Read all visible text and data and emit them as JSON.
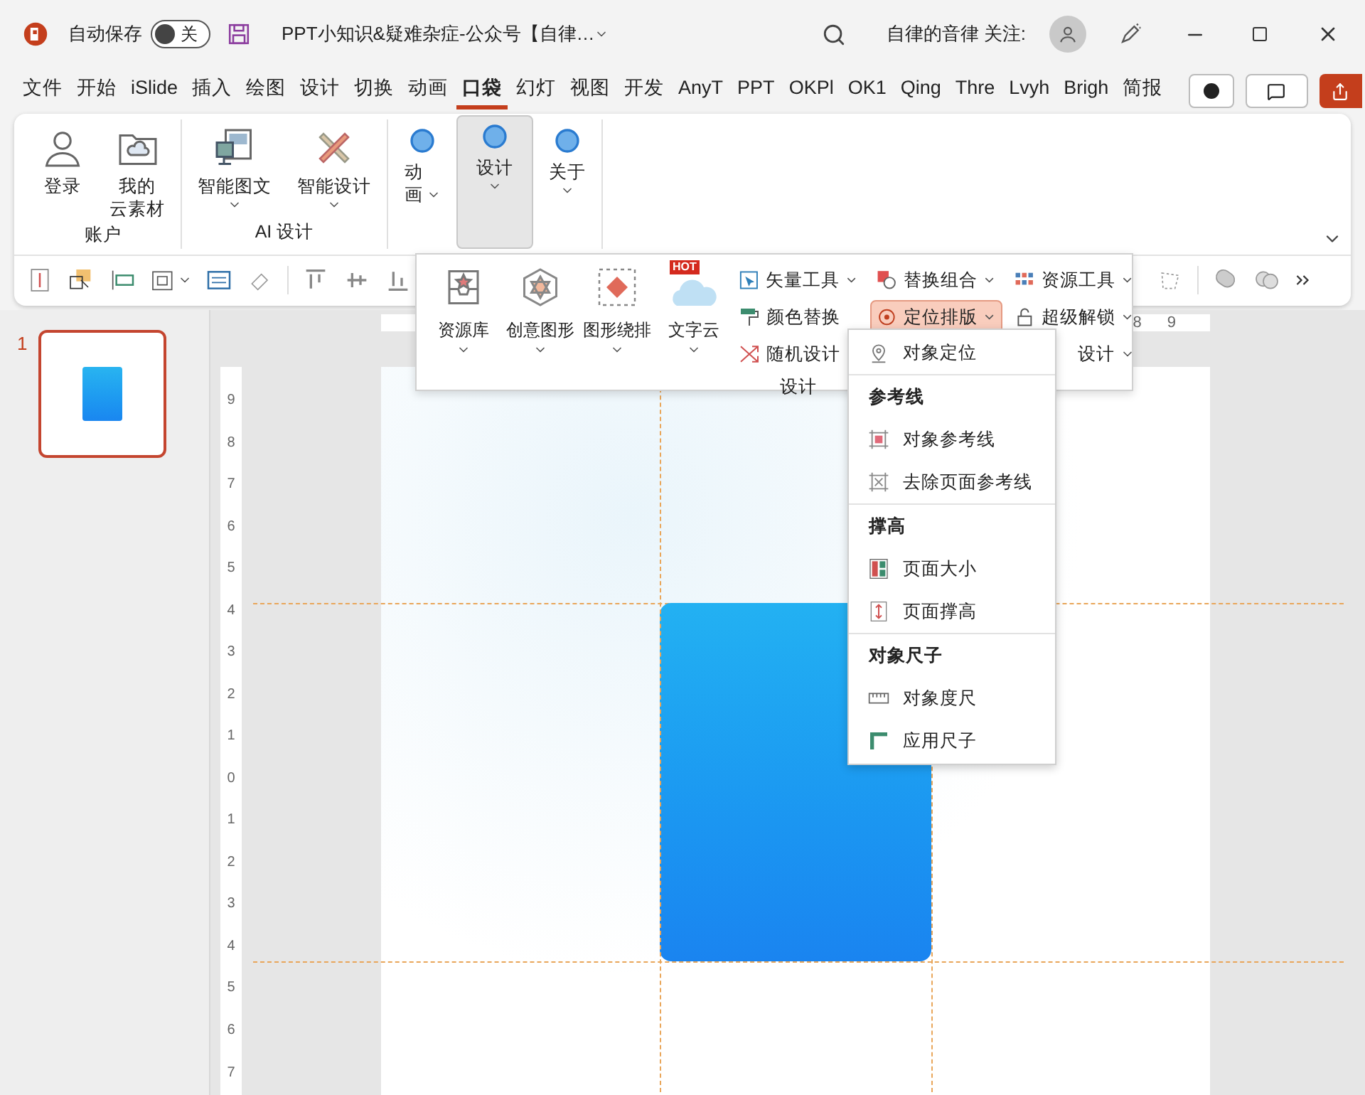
{
  "titlebar": {
    "autosave_label": "自动保存",
    "autosave_switch": {
      "on": false,
      "label": "关"
    },
    "title": "PPT小知识&疑难杂症-公众号【自律…",
    "user_label": "自律的音律 关注:"
  },
  "tabs": [
    {
      "label": "文件",
      "selected": false
    },
    {
      "label": "开始",
      "selected": false
    },
    {
      "label": "iSlide",
      "selected": false
    },
    {
      "label": "插入",
      "selected": false
    },
    {
      "label": "绘图",
      "selected": false
    },
    {
      "label": "设计",
      "selected": false
    },
    {
      "label": "切换",
      "selected": false
    },
    {
      "label": "动画",
      "selected": false
    },
    {
      "label": "口袋",
      "selected": true
    },
    {
      "label": "幻灯",
      "selected": false
    },
    {
      "label": "视图",
      "selected": false
    },
    {
      "label": "开发",
      "selected": false
    },
    {
      "label": "AnyT",
      "selected": false
    },
    {
      "label": "PPT",
      "selected": false
    },
    {
      "label": "OKPl",
      "selected": false
    },
    {
      "label": "OK1",
      "selected": false
    },
    {
      "label": "Qing",
      "selected": false
    },
    {
      "label": "Thre",
      "selected": false
    },
    {
      "label": "Lvyh",
      "selected": false
    },
    {
      "label": "Brigh",
      "selected": false
    },
    {
      "label": "简报",
      "selected": false
    }
  ],
  "ribbon": {
    "groups": [
      {
        "label": "账户",
        "buttons": [
          {
            "lines": [
              "登录"
            ],
            "dropdown": false,
            "pressed": false
          },
          {
            "lines": [
              "我的",
              "云素材"
            ],
            "dropdown": false,
            "pressed": false
          }
        ]
      },
      {
        "label": "AI 设计",
        "buttons": [
          {
            "lines": [
              "智能图文"
            ],
            "dropdown": true,
            "pressed": false
          },
          {
            "lines": [
              "智能设计"
            ],
            "dropdown": true,
            "pressed": false
          }
        ]
      },
      {
        "buttons": [
          {
            "lines": [
              "动",
              "画"
            ],
            "dropdown": true,
            "pressed": false
          },
          {
            "lines": [
              "设计"
            ],
            "dropdown": true,
            "pressed": true
          },
          {
            "lines": [
              "关于"
            ],
            "dropdown": true,
            "pressed": false
          }
        ]
      }
    ]
  },
  "design_panel": {
    "group_label": "设计",
    "large": [
      {
        "label": "资源库"
      },
      {
        "label": "创意图形"
      },
      {
        "label": "图形绕排"
      },
      {
        "label": "文字云",
        "badge": "HOT"
      }
    ],
    "columns": [
      [
        {
          "label": "矢量工具",
          "dropdown": true,
          "open": false,
          "covered": false
        },
        {
          "label": "颜色替换",
          "dropdown": false,
          "open": false,
          "covered": false
        },
        {
          "label": "随机设计",
          "dropdown": false,
          "open": false,
          "covered": false
        }
      ],
      [
        {
          "label": "替换组合",
          "dropdown": true,
          "open": false,
          "covered": false
        },
        {
          "label": "定位排版",
          "dropdown": true,
          "open": true,
          "covered": false
        }
      ],
      [
        {
          "label": "资源工具",
          "dropdown": true,
          "open": false,
          "covered": false
        },
        {
          "label": "超级解锁",
          "dropdown": true,
          "open": false,
          "covered": false
        },
        {
          "label": "设计",
          "dropdown": true,
          "open": false,
          "covered": true
        }
      ]
    ]
  },
  "menu": {
    "sections": [
      {
        "items": [
          {
            "label": "对象定位"
          }
        ]
      },
      {
        "heading": "参考线",
        "items": [
          {
            "label": "对象参考线"
          },
          {
            "label": "去除页面参考线"
          }
        ]
      },
      {
        "heading": "撑高",
        "items": [
          {
            "label": "页面大小"
          },
          {
            "label": "页面撑高"
          }
        ]
      },
      {
        "heading": "对象尺子",
        "items": [
          {
            "label": "对象度尺"
          },
          {
            "label": "应用尺子"
          }
        ]
      }
    ]
  },
  "slides": [
    {
      "number": "1",
      "selected": true
    }
  ],
  "rulers": {
    "horizontal": [
      "8",
      "9"
    ],
    "vertical": [
      "9",
      "8",
      "7",
      "6",
      "5",
      "4",
      "3",
      "2",
      "1",
      "0",
      "1",
      "2",
      "3",
      "4",
      "5",
      "6",
      "7"
    ]
  }
}
